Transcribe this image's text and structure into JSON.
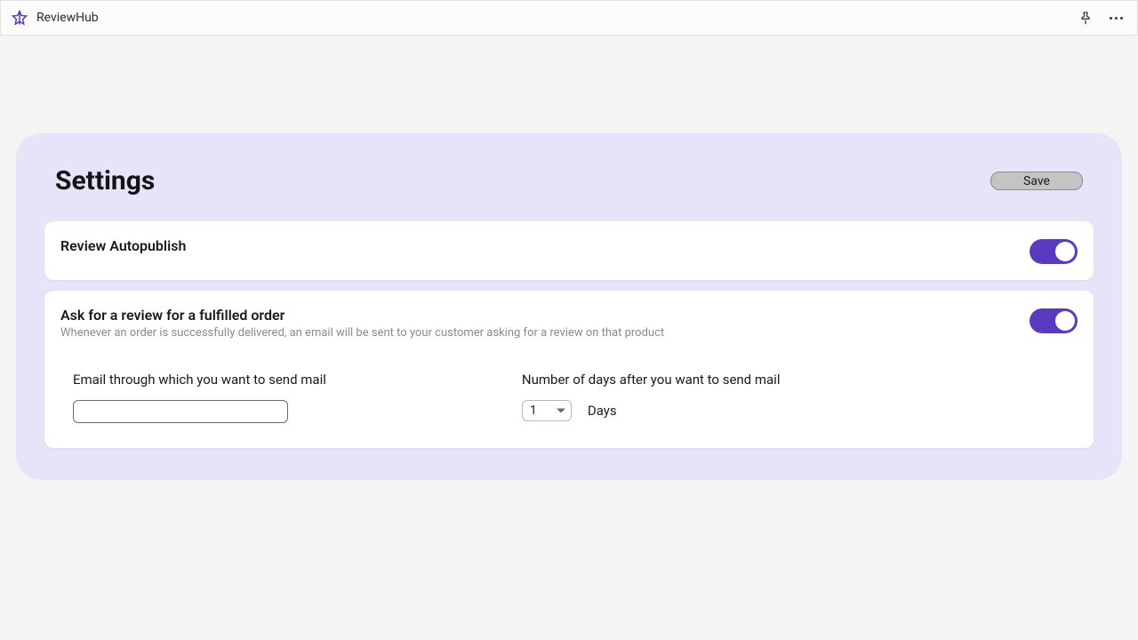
{
  "topbar": {
    "app_name": "ReviewHub"
  },
  "settings": {
    "title": "Settings",
    "save_label": "Save",
    "autopublish": {
      "title": "Review Autopublish",
      "enabled": true
    },
    "ask_review": {
      "title": "Ask for a review for a fulfilled order",
      "description": "Whenever an order is successfully delivered, an email will be sent to your customer asking for a review on that product",
      "enabled": true,
      "email_label": "Email through which you want to send mail",
      "email_value": "",
      "days_label": "Number of days after you want to send mail",
      "days_value": "1",
      "days_unit": "Days"
    }
  }
}
